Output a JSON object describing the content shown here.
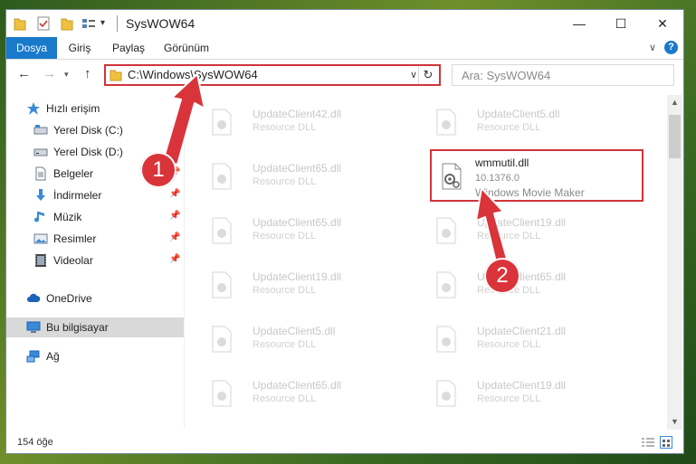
{
  "window": {
    "title": "SysWOW64",
    "controls": {
      "minimize": "—",
      "maximize": "☐",
      "close": "✕"
    }
  },
  "ribbon": {
    "tabs": [
      "Dosya",
      "Giriş",
      "Paylaş",
      "Görünüm"
    ],
    "help": "?"
  },
  "address_bar": {
    "path": "C:\\Windows\\SysWOW64",
    "search_placeholder": "Ara: SysWOW64"
  },
  "nav_pane": {
    "items": [
      {
        "label": "Hızlı erişim",
        "icon": "star-icon"
      },
      {
        "label": "Yerel Disk (C:)",
        "icon": "drive-icon",
        "pinned": true
      },
      {
        "label": "Yerel Disk (D:)",
        "icon": "drive-icon",
        "pinned": true
      },
      {
        "label": "Belgeler",
        "icon": "document-icon",
        "pinned": true
      },
      {
        "label": "İndirmeler",
        "icon": "download-icon",
        "pinned": true
      },
      {
        "label": "Müzik",
        "icon": "music-icon",
        "pinned": true
      },
      {
        "label": "Resimler",
        "icon": "pictures-icon",
        "pinned": true
      },
      {
        "label": "Videolar",
        "icon": "video-icon",
        "pinned": true
      },
      {
        "label": "OneDrive",
        "icon": "cloud-icon"
      },
      {
        "label": "Bu bilgisayar",
        "icon": "computer-icon",
        "selected": true
      },
      {
        "label": "Ağ",
        "icon": "network-icon"
      }
    ]
  },
  "files": [
    {
      "name": "UpdateClient42.dll",
      "type": "Resource DLL"
    },
    {
      "name": "UpdateClient5.dll",
      "type": "Resource DLL"
    },
    {
      "name": "UpdateClient65.dll",
      "type": "Resource DLL"
    },
    {
      "name": "UpdateClient65.dll",
      "type": "Resource DLL"
    },
    {
      "name": "UpdateClient19.dll",
      "type": "Resource DLL"
    },
    {
      "name": "UpdateClient19.dll",
      "type": "Resource DLL"
    },
    {
      "name": "UpdateClient65.dll",
      "type": "Resource DLL"
    },
    {
      "name": "UpdateClient5.dll",
      "type": "Resource DLL"
    },
    {
      "name": "UpdateClient21.dll",
      "type": "Resource DLL"
    },
    {
      "name": "UpdateClient65.dll",
      "type": "Resource DLL"
    },
    {
      "name": "UpdateClient19.dll",
      "type": "Resource DLL"
    }
  ],
  "highlighted_file": {
    "name": "wmmutil.dll",
    "version": "10.1376.0",
    "description": "Windows Movie Maker"
  },
  "status": {
    "item_count": "154 öğe"
  },
  "annotations": {
    "marker1": "1",
    "marker2": "2",
    "color": "#d9343a"
  }
}
